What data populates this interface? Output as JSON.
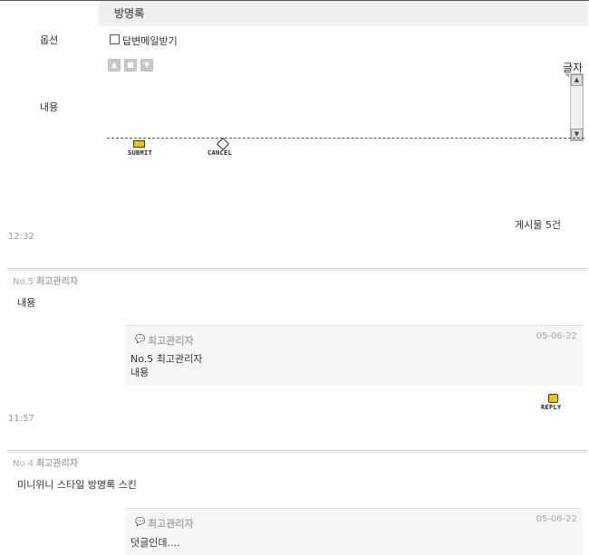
{
  "header": {
    "title": "방명록"
  },
  "form": {
    "option_label": "옵션",
    "email_reply_label": "답변메일받기",
    "content_label": "내용",
    "char_count_label": "글자",
    "submit_label": "SUBMIT",
    "cancel_label": "CANCEL"
  },
  "list": {
    "post_count": "게시물 5건",
    "posts": [
      {
        "time": "12:32",
        "no": "No.5",
        "author": "최고관리자",
        "content": "내용",
        "comment": {
          "author": "최고관리자",
          "date": "05-06-22",
          "line1": "No.5 최고관리자",
          "line2": "내용"
        },
        "reply_label": "REPLY"
      },
      {
        "time": "11:57",
        "no": "No.4",
        "author": "최고관리자",
        "content": "미니위니 스타일 방명록 스킨",
        "comment": {
          "author": "최고관리자",
          "date": "05-06-22",
          "line1": "덧글인데...."
        }
      }
    ]
  },
  "icons": {
    "move_up": "arrow-up-icon",
    "stop": "square-icon",
    "move_down": "arrow-down-icon",
    "speech": "speech-bubble-icon"
  }
}
